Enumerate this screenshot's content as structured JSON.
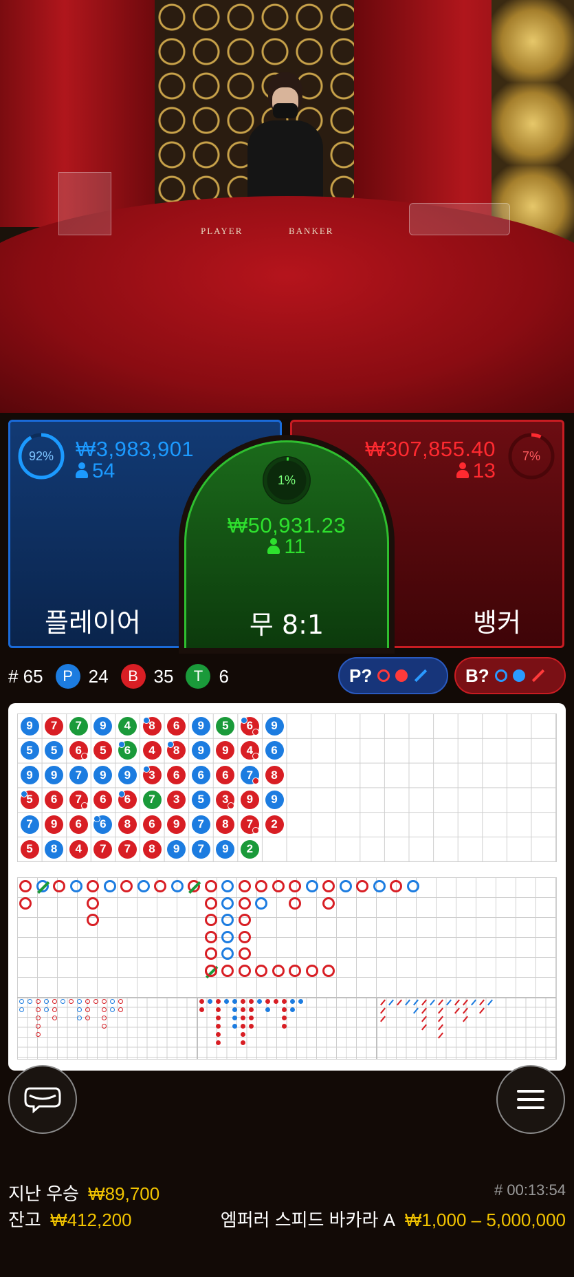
{
  "video": {
    "player_label": "PLAYER",
    "banker_label": "BANKER"
  },
  "bets": {
    "player": {
      "percent": "92%",
      "percent_value": 92,
      "amount": "₩3,983,901",
      "count": "54",
      "label": "플레이어"
    },
    "tie": {
      "percent": "1%",
      "percent_value": 1,
      "amount": "₩50,931.23",
      "count": "11",
      "label": "무 8:1"
    },
    "banker": {
      "percent": "7%",
      "percent_value": 7,
      "amount": "₩307,855.40",
      "count": "13",
      "label": "뱅커"
    }
  },
  "stats": {
    "round": "# 65",
    "p_letter": "P",
    "p_count": "24",
    "b_letter": "B",
    "b_count": "35",
    "t_letter": "T",
    "t_count": "6"
  },
  "predictions": {
    "player": "P?",
    "banker": "B?"
  },
  "colors": {
    "player": "#1c7ce0",
    "banker": "#d81e24",
    "tie": "#1a9a3a",
    "gold": "#f2c400"
  },
  "bead_road": [
    [
      "9b",
      "5b",
      "9b",
      "5r",
      "7b",
      "5r"
    ],
    [
      "7r",
      "5b",
      "9b",
      "6r",
      "9r",
      "8b"
    ],
    [
      "7g",
      "6r",
      "7b",
      "7r",
      "6r",
      "4r"
    ],
    [
      "9b",
      "5r",
      "9b",
      "6r",
      "6b",
      "7r"
    ],
    [
      "4g",
      "6g",
      "9b",
      "6r",
      "8r",
      "7r"
    ],
    [
      "8r",
      "4r",
      "3r",
      "7g",
      "6r",
      "8r"
    ],
    [
      "6r",
      "8r",
      "6r",
      "3r",
      "9r",
      "9b"
    ],
    [
      "9b",
      "9b",
      "6b",
      "5b",
      "7b",
      "7b"
    ],
    [
      "5g",
      "9r",
      "6r",
      "3r",
      "8r",
      "9b"
    ],
    [
      "6r",
      "4r",
      "7b",
      "9r",
      "7r",
      "2g"
    ],
    [
      "9b",
      "6b",
      "8r",
      "9b",
      "2r",
      ""
    ]
  ],
  "footer": {
    "last_win_label": "지난 우승",
    "last_win_amount": "₩89,700",
    "balance_label": "잔고",
    "balance_amount": "₩412,200",
    "game_id": "# 00:13:54",
    "table_name": "엠퍼러 스피드 바카라 A",
    "limits": "₩1,000 – 5,000,000"
  },
  "icons": {
    "chat": "chat-icon",
    "menu": "menu-icon"
  }
}
